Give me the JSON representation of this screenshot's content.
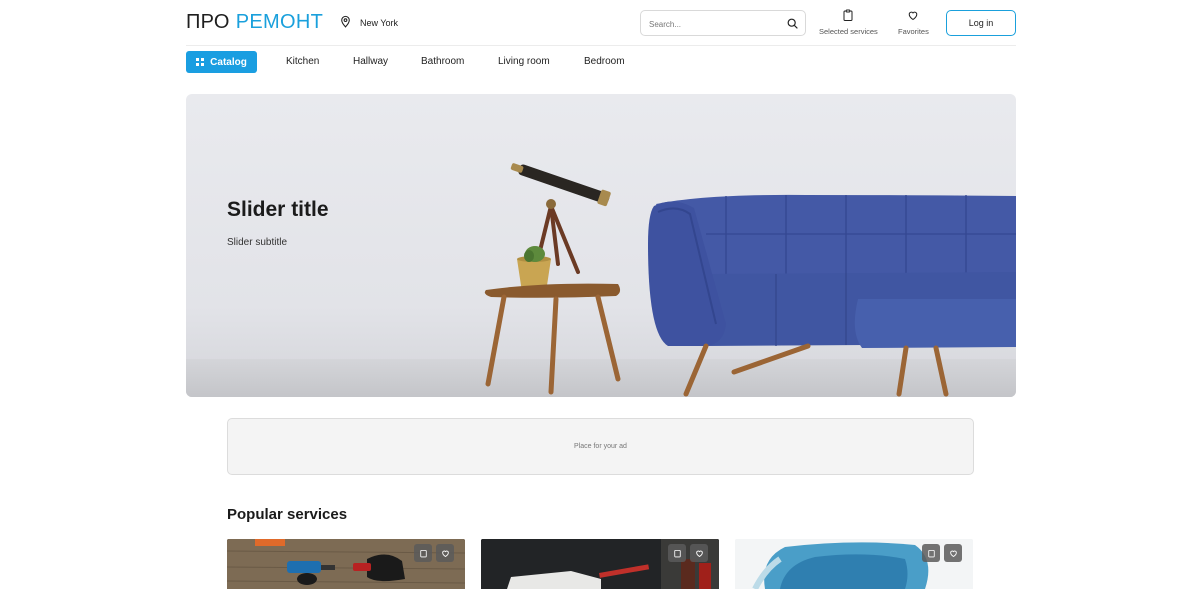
{
  "header": {
    "logo_part1": "ПРО",
    "logo_part2": "РЕМОНТ",
    "location": "New York",
    "location_icon": "map-pin-icon",
    "search_placeholder": "Search...",
    "search_icon": "search-icon",
    "selected_services_label": "Selected services",
    "selected_services_icon": "clipboard-icon",
    "favorites_label": "Favorites",
    "favorites_icon": "heart-icon",
    "login_label": "Log in"
  },
  "nav": {
    "catalog_label": "Catalog",
    "catalog_icon": "grid-icon",
    "items": [
      "Kitchen",
      "Hallway",
      "Bathroom",
      "Living room",
      "Bedroom"
    ]
  },
  "hero": {
    "title": "Slider title",
    "subtitle": "Slider subtitle"
  },
  "ad": {
    "label": "Place for your ad"
  },
  "popular": {
    "title": "Popular services",
    "card_actions": [
      "clipboard-icon",
      "heart-icon"
    ]
  },
  "colors": {
    "accent": "#1aa0dc",
    "catalog_bg": "#1a9ee1",
    "sofa": "#3f55a3"
  }
}
